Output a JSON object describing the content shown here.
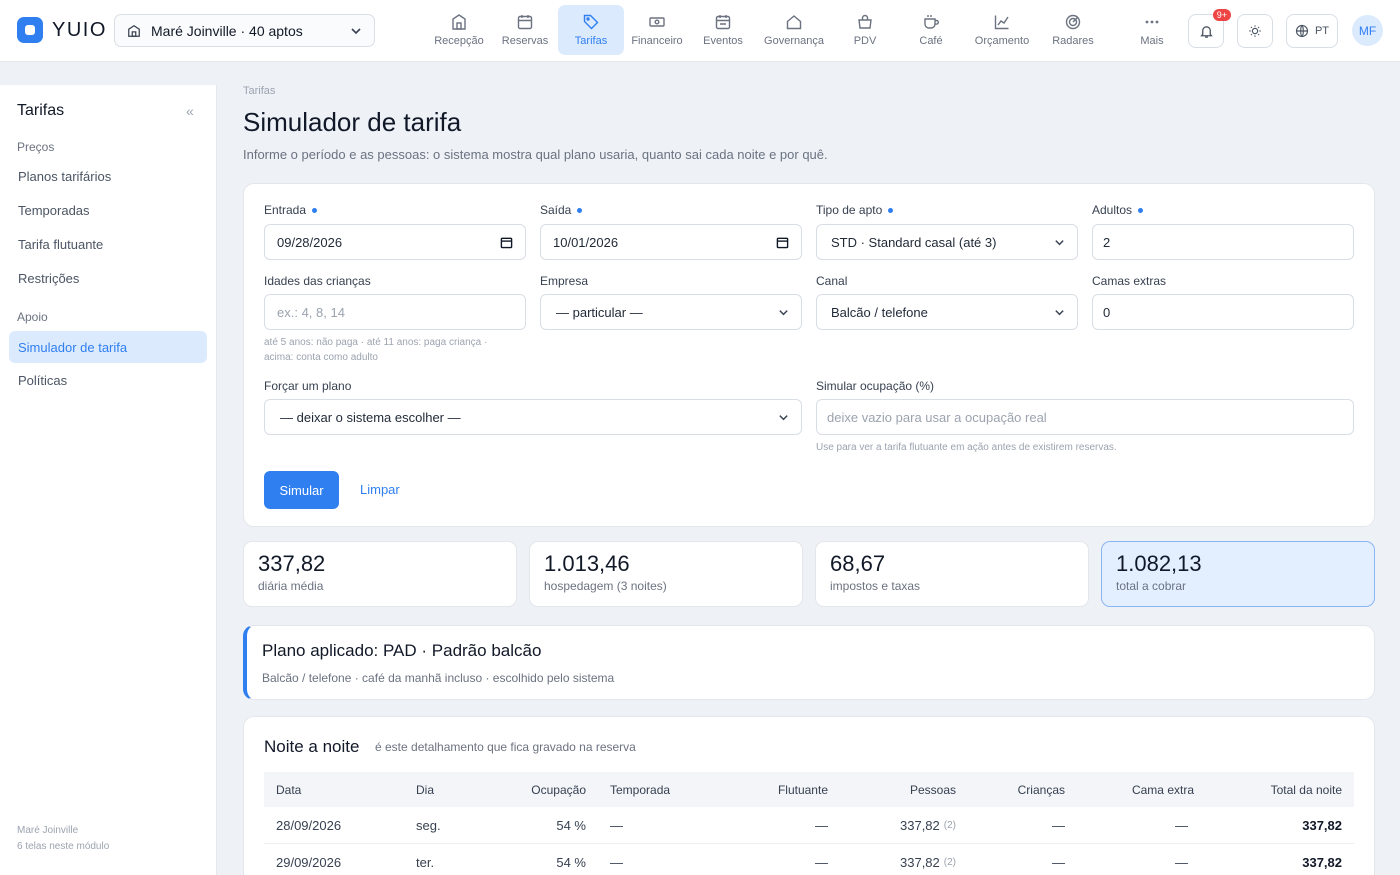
{
  "app": {
    "name": "YUIO",
    "property": "Maré Joinville · 40 aptos"
  },
  "nav": [
    {
      "label": "Recepção",
      "icon": "building-icon"
    },
    {
      "label": "Reservas",
      "icon": "calendar-icon"
    },
    {
      "label": "Tarifas",
      "icon": "tag-icon"
    },
    {
      "label": "Financeiro",
      "icon": "money-icon"
    },
    {
      "label": "Eventos",
      "icon": "events-icon"
    },
    {
      "label": "Governança",
      "icon": "house-icon"
    },
    {
      "label": "PDV",
      "icon": "bag-icon"
    },
    {
      "label": "Café",
      "icon": "coffee-icon"
    },
    {
      "label": "Orçamento",
      "icon": "chart-icon"
    },
    {
      "label": "Radares",
      "icon": "radar-icon"
    },
    {
      "label": "Mais",
      "icon": "more-icon"
    }
  ],
  "topbar": {
    "notifications_badge": "9+",
    "language": "PT",
    "avatar": "MF"
  },
  "sidebar": {
    "title": "Tarifas",
    "group_prices": "Preços",
    "group_support": "Apoio",
    "items_prices": [
      "Planos tarifários",
      "Temporadas",
      "Tarifa flutuante",
      "Restrições"
    ],
    "items_support": [
      "Simulador de tarifa",
      "Políticas"
    ],
    "footer_property": "Maré Joinville",
    "footer_count": "6 telas neste módulo"
  },
  "page": {
    "breadcrumb": "Tarifas",
    "title": "Simulador de tarifa",
    "subtitle": "Informe o período e as pessoas: o sistema mostra qual plano usaria, quanto sai cada noite e por quê."
  },
  "form": {
    "entrada_label": "Entrada",
    "entrada_value": "09/28/2026",
    "saida_label": "Saída",
    "saida_value": "10/01/2026",
    "tipo_label": "Tipo de apto",
    "tipo_value": "STD · Standard casal (até 3)",
    "adultos_label": "Adultos",
    "adultos_value": "2",
    "idades_label": "Idades das crianças",
    "idades_placeholder": "ex.: 4, 8, 14",
    "idades_hint_1": "até 5 anos: não paga · até 11 anos: paga criança ·",
    "idades_hint_2": "acima: conta como adulto",
    "empresa_label": "Empresa",
    "empresa_value": "— particular —",
    "canal_label": "Canal",
    "canal_value": "Balcão / telefone",
    "camas_label": "Camas extras",
    "camas_value": "0",
    "forcar_label": "Forçar um plano",
    "forcar_value": "— deixar o sistema escolher —",
    "ocupacao_label": "Simular ocupação (%)",
    "ocupacao_placeholder": "deixe vazio para usar a ocupação real",
    "ocupacao_hint": "Use para ver a tarifa flutuante em ação antes de existirem reservas.",
    "simular": "Simular",
    "limpar": "Limpar"
  },
  "stats": [
    {
      "value": "337,82",
      "label": "diária média"
    },
    {
      "value": "1.013,46",
      "label": "hospedagem (3 noites)"
    },
    {
      "value": "68,67",
      "label": "impostos e taxas"
    },
    {
      "value": "1.082,13",
      "label": "total a cobrar"
    }
  ],
  "plan": {
    "title": "Plano aplicado: PAD · Padrão balcão",
    "subtitle": "Balcão / telefone · café da manhã incluso · escolhido pelo sistema"
  },
  "nights": {
    "title": "Noite a noite",
    "subtitle": "é este detalhamento que fica gravado na reserva",
    "columns": [
      "Data",
      "Dia",
      "Ocupação",
      "Temporada",
      "Flutuante",
      "Pessoas",
      "Crianças",
      "Cama extra",
      "Total da noite"
    ],
    "rows": [
      {
        "data": "28/09/2026",
        "dia": "seg.",
        "ocupacao": "54 %",
        "temporada": "—",
        "flutuante": "—",
        "pessoas": "337,82",
        "pessoas_qtd": "(2)",
        "criancas": "—",
        "cama": "—",
        "total": "337,82"
      },
      {
        "data": "29/09/2026",
        "dia": "ter.",
        "ocupacao": "54 %",
        "temporada": "—",
        "flutuante": "—",
        "pessoas": "337,82",
        "pessoas_qtd": "(2)",
        "criancas": "—",
        "cama": "—",
        "total": "337,82"
      }
    ]
  }
}
